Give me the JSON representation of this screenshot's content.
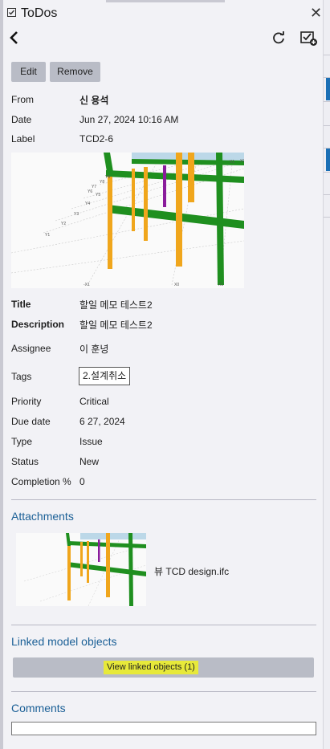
{
  "window": {
    "title": "ToDos",
    "close_glyph": "✕"
  },
  "nav": {
    "back_icon": "chevron-left-icon",
    "refresh_icon": "refresh-icon",
    "complete_icon": "checklist-add-icon"
  },
  "actions": {
    "edit_label": "Edit",
    "remove_label": "Remove"
  },
  "meta": {
    "from_label": "From",
    "from_value": "신 용석",
    "date_label": "Date",
    "date_value": "Jun 27, 2024 10:16 AM",
    "label_label": "Label",
    "label_value": "TCD2-6"
  },
  "details": {
    "title_label": "Title",
    "title_value": "할일 메모 테스트2",
    "description_label": "Description",
    "description_value": "할일 메모 테스트2",
    "assignee_label": "Assignee",
    "assignee_value": "이 훈녕",
    "tags_label": "Tags",
    "tag_value": "2.설계취소",
    "priority_label": "Priority",
    "priority_value": "Critical",
    "due_label": "Due date",
    "due_value": "6 27, 2024",
    "type_label": "Type",
    "type_value": "Issue",
    "status_label": "Status",
    "status_value": "New",
    "completion_label": "Completion %",
    "completion_value": "0"
  },
  "thumbnail": {
    "grid_labels": [
      "Y9",
      "Y8",
      "Y7",
      "Y6",
      "Y5",
      "Y4",
      "Y3",
      "Y2",
      "Y1",
      "X1",
      "X0",
      "-X1",
      "X1",
      "X2"
    ]
  },
  "attachments": {
    "heading": "Attachments",
    "file_name": "뷰 TCD design.ifc"
  },
  "linked": {
    "heading": "Linked model objects",
    "button_label": "View linked objects (1)"
  },
  "comments": {
    "heading": "Comments",
    "placeholder": ""
  },
  "colors": {
    "accent": "#1a5f96",
    "button_bg": "#b9bcc6",
    "highlight": "#e7e93a",
    "panel_bg": "#f2f2f6",
    "beam_green": "#1f8f1f",
    "column_orange": "#f0a61c",
    "column_purple": "#8a1c9c"
  }
}
